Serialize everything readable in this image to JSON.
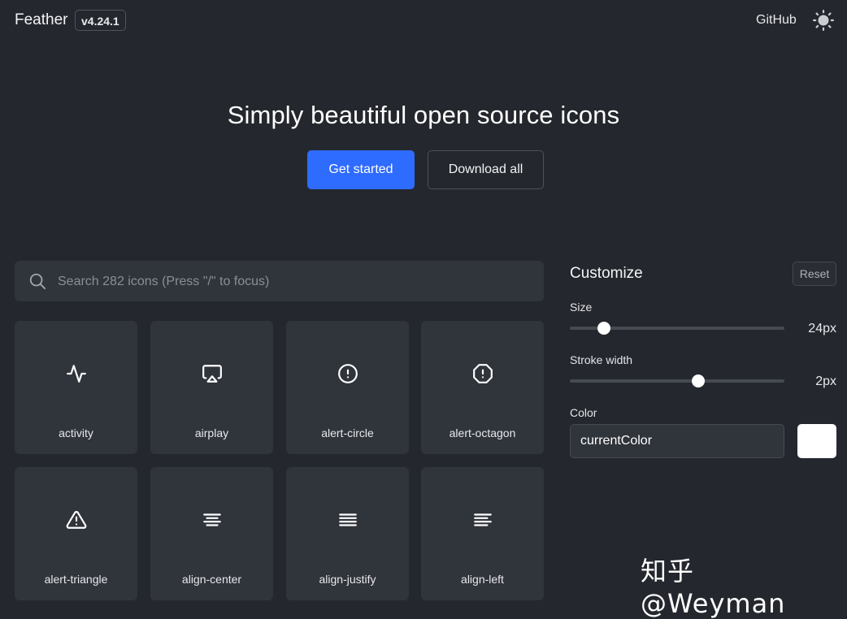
{
  "header": {
    "brand": "Feather",
    "version": "v4.24.1",
    "github_label": "GitHub",
    "theme_icon": "sun-icon"
  },
  "hero": {
    "title": "Simply beautiful open source icons",
    "primary_button": "Get started",
    "secondary_button": "Download all"
  },
  "search": {
    "placeholder": "Search 282 icons (Press \"/\" to focus)",
    "icon": "search-icon"
  },
  "icons": [
    {
      "label": "activity",
      "icon": "activity-icon"
    },
    {
      "label": "airplay",
      "icon": "airplay-icon"
    },
    {
      "label": "alert-circle",
      "icon": "alert-circle-icon"
    },
    {
      "label": "alert-octagon",
      "icon": "alert-octagon-icon"
    },
    {
      "label": "alert-triangle",
      "icon": "alert-triangle-icon"
    },
    {
      "label": "align-center",
      "icon": "align-center-icon"
    },
    {
      "label": "align-justify",
      "icon": "align-justify-icon"
    },
    {
      "label": "align-left",
      "icon": "align-left-icon"
    }
  ],
  "customize": {
    "title": "Customize",
    "reset_label": "Reset",
    "size": {
      "label": "Size",
      "value": "24px",
      "level": 0.16
    },
    "stroke": {
      "label": "Stroke width",
      "value": "2px",
      "level": 0.6
    },
    "color": {
      "label": "Color",
      "value": "currentColor",
      "swatch": "#ffffff"
    }
  },
  "colors": {
    "background": "#24272d",
    "card": "#30343b",
    "accent": "#2e6bff"
  },
  "watermark": "知乎 @Weyman"
}
